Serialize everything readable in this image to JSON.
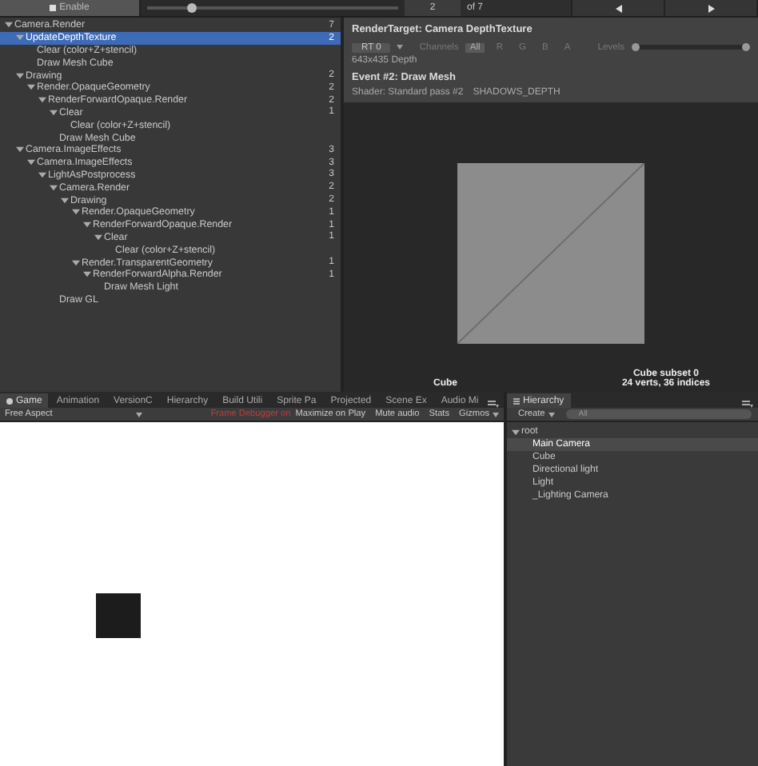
{
  "toolbar": {
    "enable": "Enable",
    "frame_slider": {
      "level": 0.18
    },
    "frame_field": "2",
    "frame_total": "of 7"
  },
  "tree": [
    {
      "label": "Camera.Render",
      "count": "7",
      "selected": false,
      "expanded": true,
      "children": [
        {
          "label": "UpdateDepthTexture",
          "count": "2",
          "selected": true,
          "expanded": true,
          "children": [
            {
              "label": "Clear (color+Z+stencil)",
              "selected": false
            },
            {
              "label": "Draw Mesh Cube",
              "selected": false
            }
          ]
        },
        {
          "label": "Drawing",
          "count": "2",
          "selected": false,
          "expanded": true,
          "children": [
            {
              "label": "Render.OpaqueGeometry",
              "count": "2",
              "selected": false,
              "expanded": true,
              "children": [
                {
                  "label": "RenderForwardOpaque.Render",
                  "count": "2",
                  "selected": false,
                  "expanded": true,
                  "children": [
                    {
                      "label": "Clear",
                      "count": "1",
                      "selected": false,
                      "expanded": true,
                      "children": [
                        {
                          "label": "Clear (color+Z+stencil)",
                          "selected": false
                        }
                      ]
                    },
                    {
                      "label": "Draw Mesh Cube",
                      "selected": false
                    }
                  ]
                }
              ]
            }
          ]
        },
        {
          "label": "Camera.ImageEffects",
          "count": "3",
          "selected": false,
          "expanded": true,
          "children": [
            {
              "label": "Camera.ImageEffects",
              "count": "3",
              "selected": false,
              "expanded": true,
              "children": [
                {
                  "label": "LightAsPostprocess",
                  "count": "3",
                  "selected": false,
                  "expanded": true,
                  "children": [
                    {
                      "label": "Camera.Render",
                      "count": "2",
                      "selected": false,
                      "expanded": true,
                      "children": [
                        {
                          "label": "Drawing",
                          "count": "2",
                          "selected": false,
                          "expanded": true,
                          "children": [
                            {
                              "label": "Render.OpaqueGeometry",
                              "count": "1",
                              "selected": false,
                              "expanded": true,
                              "children": [
                                {
                                  "label": "RenderForwardOpaque.Render",
                                  "count": "1",
                                  "selected": false,
                                  "expanded": true,
                                  "children": [
                                    {
                                      "label": "Clear",
                                      "count": "1",
                                      "selected": false,
                                      "expanded": true,
                                      "children": [
                                        {
                                          "label": "Clear (color+Z+stencil)",
                                          "selected": false
                                        }
                                      ]
                                    }
                                  ]
                                }
                              ]
                            },
                            {
                              "label": "Render.TransparentGeometry",
                              "count": "1",
                              "selected": false,
                              "expanded": true,
                              "children": [
                                {
                                  "label": "RenderForwardAlpha.Render",
                                  "count": "1",
                                  "selected": false,
                                  "expanded": true,
                                  "children": [
                                    {
                                      "label": "Draw Mesh Light",
                                      "selected": false
                                    }
                                  ]
                                }
                              ]
                            }
                          ]
                        }
                      ]
                    },
                    {
                      "label": "Draw GL",
                      "selected": false
                    }
                  ]
                }
              ]
            }
          ]
        }
      ]
    }
  ],
  "render_target": {
    "title": "RenderTarget: Camera DepthTexture",
    "rt": "RT 0",
    "channels_label": "Channels",
    "channels": [
      {
        "label": "All",
        "selected": true
      },
      {
        "label": "R",
        "selected": false
      },
      {
        "label": "G",
        "selected": false
      },
      {
        "label": "B",
        "selected": false
      },
      {
        "label": "A",
        "selected": false
      }
    ],
    "levels_label": "Levels",
    "levels": {
      "level": 1
    },
    "size": "643x435 Depth"
  },
  "event": {
    "title": "Event #2: Draw Mesh",
    "shader": "Shader: Standard pass #2",
    "keywords": "SHADOWS_DEPTH"
  },
  "preview": {
    "mesh_label": "Cube",
    "subset_label": "Cube subset 0",
    "stats": "24 verts, 36 indices"
  },
  "tabs": [
    {
      "label": "Game",
      "selected": true
    },
    {
      "label": "Animation",
      "selected": false
    },
    {
      "label": "VersionC",
      "selected": false
    },
    {
      "label": "Hierarchy",
      "selected": false
    },
    {
      "label": "Build Utili",
      "selected": false
    },
    {
      "label": "Sprite Pa",
      "selected": false
    },
    {
      "label": "Projected",
      "selected": false
    },
    {
      "label": "Scene Ex",
      "selected": false
    },
    {
      "label": "Audio Mi",
      "selected": false
    }
  ],
  "game_toolbar": {
    "aspect": "Free Aspect",
    "status": "Frame Debugger on",
    "buttons": [
      "Maximize on Play",
      "Mute audio",
      "Stats",
      "Gizmos"
    ]
  },
  "hierarchy": {
    "tab": "Hierarchy",
    "create": "Create",
    "search_placeholder": "All",
    "tree": [
      {
        "label": "root",
        "selected": false,
        "expanded": true,
        "children": [
          {
            "label": "Main Camera",
            "selected": true
          },
          {
            "label": "Cube",
            "selected": false
          },
          {
            "label": "Directional light",
            "selected": false
          },
          {
            "label": "Light",
            "selected": false
          },
          {
            "label": "_Lighting Camera",
            "selected": false
          }
        ]
      }
    ]
  }
}
